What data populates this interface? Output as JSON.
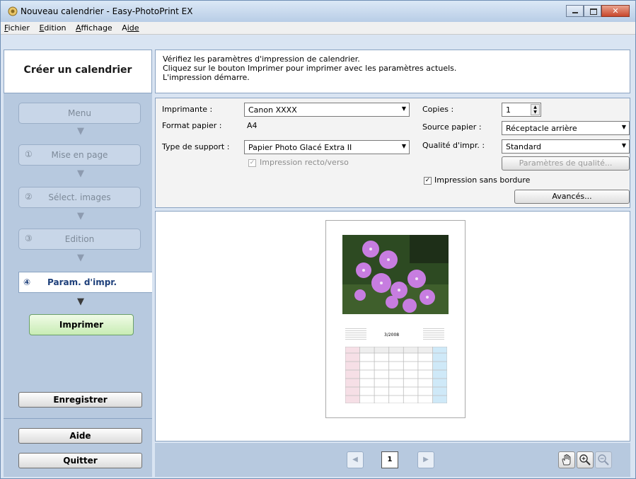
{
  "window": {
    "title": "Nouveau calendrier - Easy-PhotoPrint EX"
  },
  "menu": {
    "items": [
      {
        "first": "F",
        "rest": "ichier"
      },
      {
        "first": "E",
        "rest": "dition"
      },
      {
        "first": "A",
        "rest": "ffichage"
      },
      {
        "first": "A",
        "rest": "ide",
        "prefix": ""
      }
    ]
  },
  "left": {
    "title": "Créer un calendrier",
    "menu_label": "Menu",
    "steps": [
      {
        "num": "①",
        "label": "Mise en page"
      },
      {
        "num": "②",
        "label": "Sélect. images"
      },
      {
        "num": "③",
        "label": "Edition"
      },
      {
        "num": "④",
        "label": "Param. d'impr."
      }
    ],
    "print_label": "Imprimer",
    "save_label": "Enregistrer",
    "help_label": "Aide",
    "quit_label": "Quitter"
  },
  "info": {
    "line1": "Vérifiez les paramètres d'impression de calendrier.",
    "line2": "Cliquez sur le bouton Imprimer pour imprimer avec les paramètres actuels.",
    "line3": "L'impression démarre."
  },
  "settings": {
    "printer_label": "Imprimante :",
    "printer_value": "Canon XXXX",
    "paper_size_label": "Format papier :",
    "paper_size_value": "A4",
    "media_label": "Type de support :",
    "media_value": "Papier Photo Glacé Extra II",
    "duplex_label": "Impression recto/verso",
    "copies_label": "Copies :",
    "copies_value": "1",
    "source_label": "Source papier :",
    "source_value": "Réceptacle arrière",
    "quality_label": "Qualité d'impr. :",
    "quality_value": "Standard",
    "quality_settings_btn": "Paramètres de qualité...",
    "borderless_label": "Impression sans bordure",
    "advanced_btn": "Avancés..."
  },
  "preview": {
    "calendar_month": "3/2008",
    "page_number": "1"
  },
  "colors": {
    "accent": "#1d3f7a",
    "panel": "#b7c9df",
    "print_green": "#c8ecb4"
  }
}
